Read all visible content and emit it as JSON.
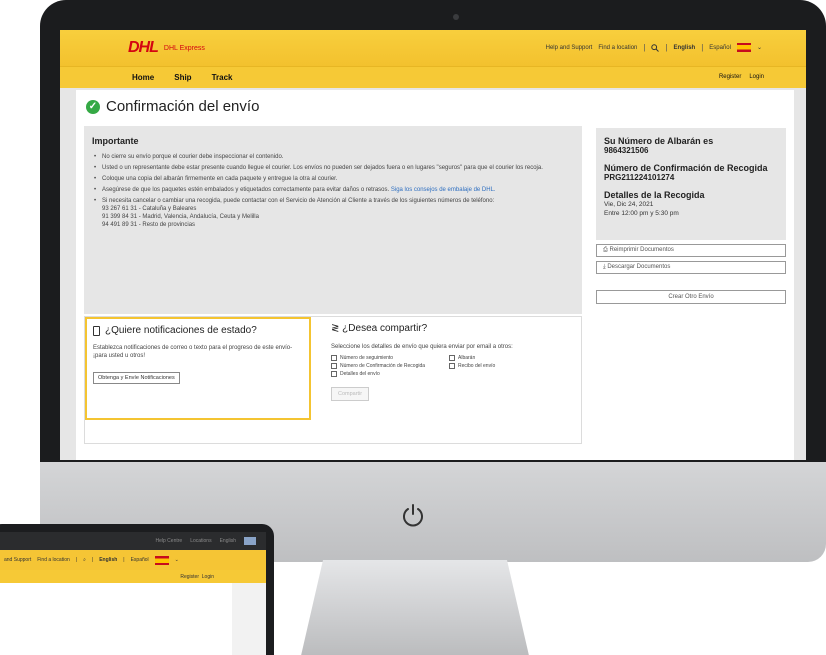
{
  "header": {
    "logo": "DHL",
    "logo_sub": "DHL Express",
    "util": {
      "help": "Help and Support",
      "find": "Find a location",
      "english": "English",
      "espanol": "Español"
    }
  },
  "nav": {
    "items": [
      "Home",
      "Ship",
      "Track"
    ],
    "register": "Register",
    "login": "Login"
  },
  "page": {
    "title": "Confirmación del envío",
    "important": {
      "heading": "Importante",
      "bullets": [
        "No cierre su envío porque el courier debe inspeccionar el contenido.",
        "Usted o un representante debe estar presente cuando llegue el courier. Los envíos no pueden ser dejados fuera o en lugares \"seguros\" para que el courier los recoja.",
        "Coloque una copia del albarán firmemente en cada paquete y entregue la otra al courier.",
        "Asegúrese de que los paquetes estén embalados y etiquetados correctamente para evitar daños o retrasos.",
        "Si necesita cancelar o cambiar una recogida, puede contactar con el Servicio de Atención al Cliente a través de los siguientes números de teléfono:"
      ],
      "link": "Siga los consejos de embalaje de DHL.",
      "phones": [
        "93 267 61 31 - Cataluña y Baleares",
        "91 399 84 31 - Madrid, Valencia, Andalucía, Ceuta y Melilla",
        "94 491 89 31 - Resto de provincias"
      ]
    },
    "notifications": {
      "title": "¿Quiere notificaciones de estado?",
      "text": "Establezca notificaciones de correo o texto para el progreso de este envío- ¡para usted u otros!",
      "button": "Obtenga y Envíe Notificaciones"
    },
    "share": {
      "title": "¿Desea compartir?",
      "text": "Seleccione los detalles de envío que quiera enviar por email a otros:",
      "options": [
        "Número de seguimiento",
        "Albarán",
        "Número de Confirmación de Recogida",
        "Recibo del envío",
        "Detalles del envío"
      ],
      "button": "Compartir"
    },
    "side": {
      "albaran_label": "Su Número de Albarán es",
      "albaran_value": "9864321506",
      "recogida_label": "Número de Confirmación de Recogida",
      "recogida_value": "PRG211224101274",
      "detalles_label": "Detalles de la Recogida",
      "detalles_date": "Vie, Dic 24, 2021",
      "detalles_time": "Entre 12:00 pm y 5:30 pm",
      "btn_print": "Reimprimir Documentos",
      "btn_download": "Descargar Documentos",
      "btn_new": "Crear Otro Envío"
    }
  },
  "laptop": {
    "top_links": [
      "Help Centre",
      "Locations",
      "English"
    ],
    "help": "and Support",
    "find": "Find a location",
    "english": "English",
    "espanol": "Español",
    "register": "Register",
    "login": "Login"
  }
}
